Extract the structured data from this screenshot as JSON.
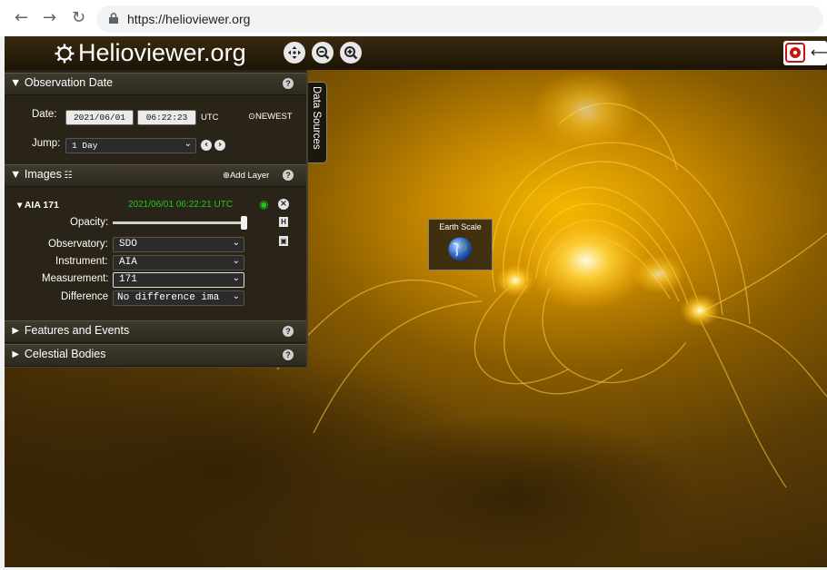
{
  "browser": {
    "back_icon": "arrow-left-icon",
    "forward_icon": "arrow-right-icon",
    "reload_icon": "reload-icon",
    "url": "https://helioviewer.org"
  },
  "app": {
    "logo": "Helioviewer.org",
    "top_buttons": [
      "center-icon",
      "zoom-out-icon",
      "zoom-in-icon"
    ],
    "right_tools": [
      "share-icon",
      "expand-icon"
    ]
  },
  "observation_date": {
    "title": "Observation Date",
    "date_label": "Date:",
    "date_value": "2021/06/01",
    "time_value": "06:22:23",
    "utc": "UTC",
    "newest": "NEWEST",
    "jump_label": "Jump:",
    "jump_value": "1 Day"
  },
  "images": {
    "title": "Images",
    "add_layer": "Add Layer",
    "layer_name": "AIA 171",
    "layer_time": "2021/06/01 06:22:21 UTC",
    "opacity_label": "Opacity:",
    "opacity_value": 1.0,
    "observatory_label": "Observatory:",
    "observatory_value": "SDO",
    "instrument_label": "Instrument:",
    "instrument_value": "AIA",
    "measurement_label": "Measurement:",
    "measurement_value": "171",
    "difference_label": "Difference",
    "difference_value": "No difference ima"
  },
  "features": {
    "title": "Features and Events"
  },
  "celestial": {
    "title": "Celestial Bodies"
  },
  "data_sources_tab": "Data Sources",
  "earth_scale": "Earth Scale",
  "colors": {
    "accent_green": "#1ec71e",
    "sun_gold": "#e0a000",
    "panel_bg": "#2a2418"
  }
}
